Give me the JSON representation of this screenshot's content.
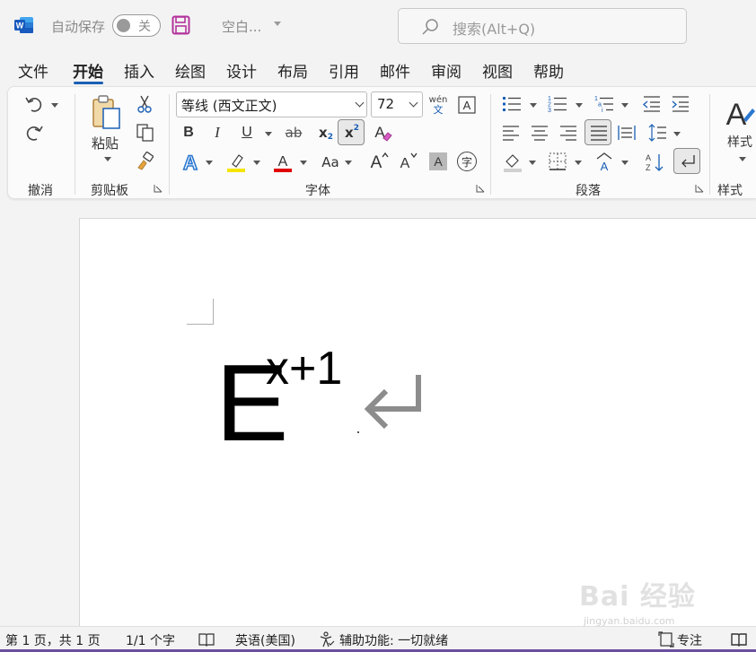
{
  "titlebar": {
    "autosave_label": "自动保存",
    "toggle_state": "关",
    "doc_title": "空白...",
    "search_placeholder": "搜索(Alt+Q)"
  },
  "tabs": [
    {
      "label": "文件",
      "active": false
    },
    {
      "label": "开始",
      "active": true
    },
    {
      "label": "插入",
      "active": false
    },
    {
      "label": "绘图",
      "active": false
    },
    {
      "label": "设计",
      "active": false
    },
    {
      "label": "布局",
      "active": false
    },
    {
      "label": "引用",
      "active": false
    },
    {
      "label": "邮件",
      "active": false
    },
    {
      "label": "审阅",
      "active": false
    },
    {
      "label": "视图",
      "active": false
    },
    {
      "label": "帮助",
      "active": false
    }
  ],
  "ribbon": {
    "groups": {
      "undo": "撤消",
      "clipboard": "剪贴板",
      "font": "字体",
      "paragraph": "段落",
      "styles": "样式"
    },
    "paste_label": "粘贴",
    "styles_label": "样式",
    "font_name": "等线 (西文正文)",
    "font_size": "72",
    "phonetic_top": "wén",
    "phonetic_bottom": "文",
    "bold": "B",
    "italic": "I",
    "underline": "U",
    "strikethrough": "ab",
    "subscript": "x",
    "subscript_mark": "2",
    "superscript": "x",
    "superscript_mark": "2",
    "change_case": "Aa",
    "enclose_char": "字",
    "colors": {
      "highlight": "#f5e400",
      "font_color": "#e00000",
      "accent": "#1a5fb4",
      "text_effect": "#2b78d0"
    }
  },
  "document": {
    "base": "E",
    "superscript": "x+1"
  },
  "statusbar": {
    "page": "第 1 页，共 1 页",
    "words": "1/1 个字",
    "language": "英语(美国)",
    "accessibility": "辅助功能: 一切就绪",
    "focus": "专注"
  },
  "watermark": {
    "main": "Bai 经验",
    "sub": "jingyan.baidu.com"
  }
}
